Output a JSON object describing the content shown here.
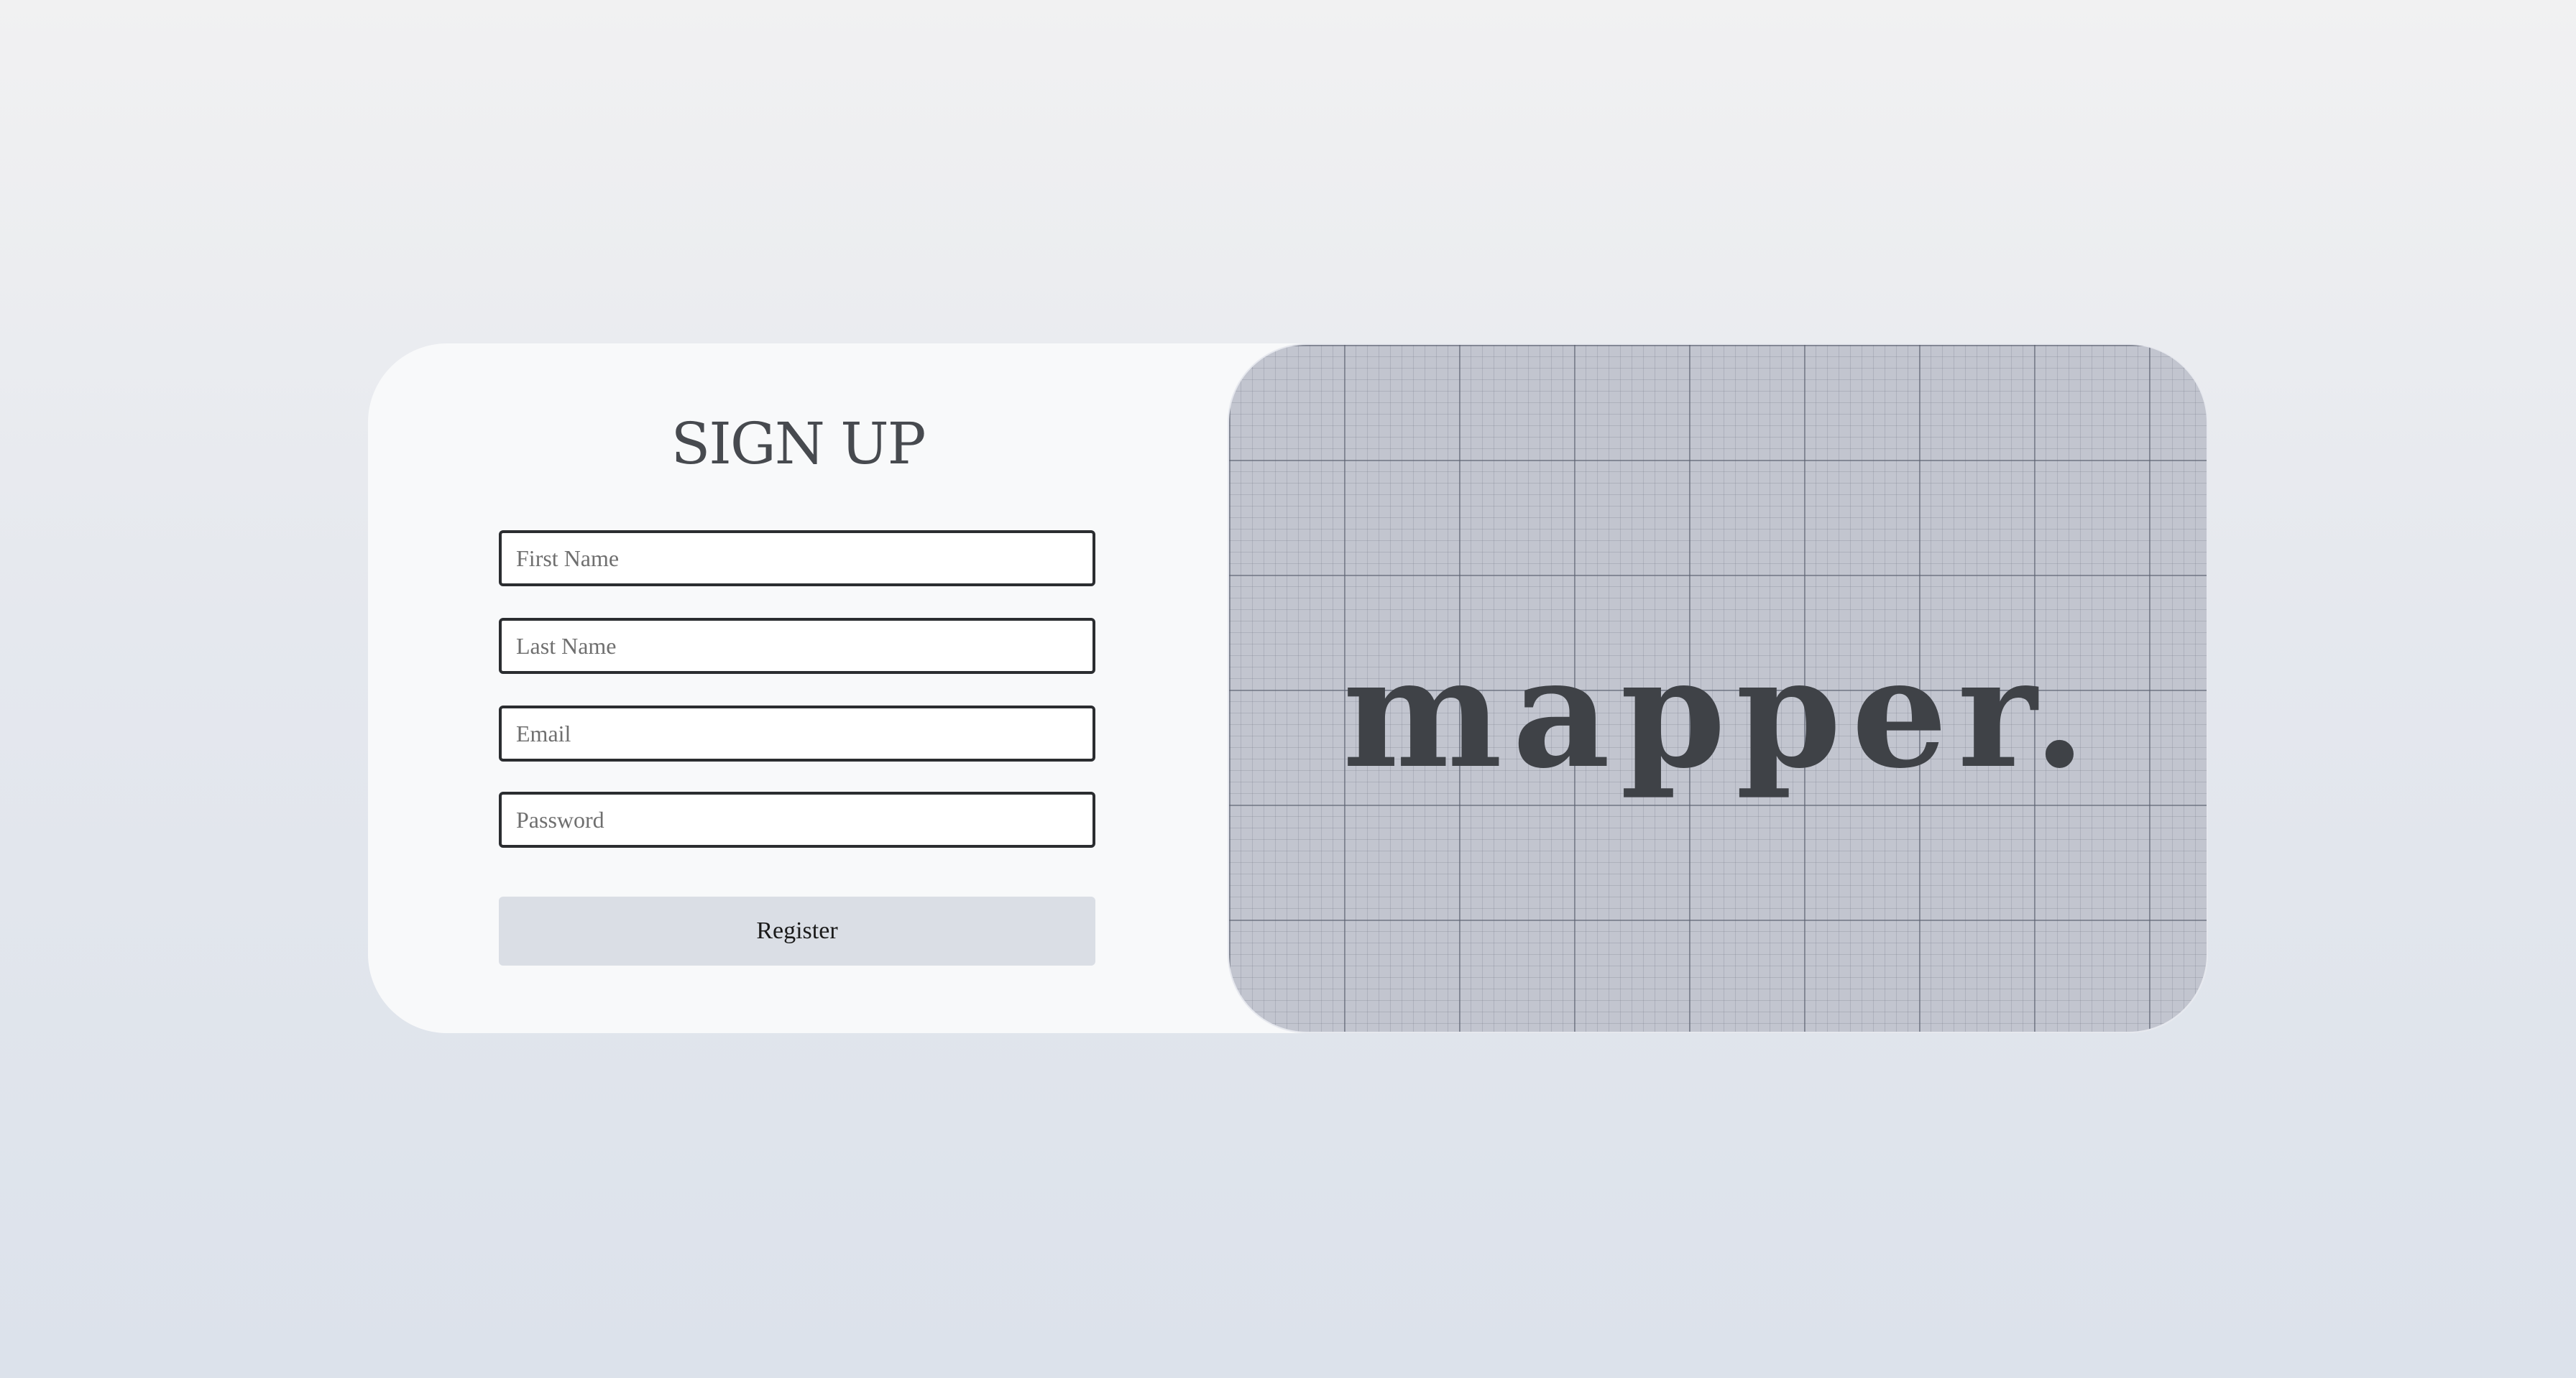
{
  "signup": {
    "title": "SIGN UP",
    "fields": {
      "first_name": {
        "placeholder": "First Name",
        "value": ""
      },
      "last_name": {
        "placeholder": "Last Name",
        "value": ""
      },
      "email": {
        "placeholder": "Email",
        "value": ""
      },
      "password": {
        "placeholder": "Password",
        "value": ""
      }
    },
    "register_label": "Register"
  },
  "brand": {
    "logo_text": "mapper."
  },
  "colors": {
    "card_background": "#f8f9fa",
    "grid_background": "#c2c5cf",
    "button_background": "#dadee5",
    "text_dark": "#3f4247"
  }
}
